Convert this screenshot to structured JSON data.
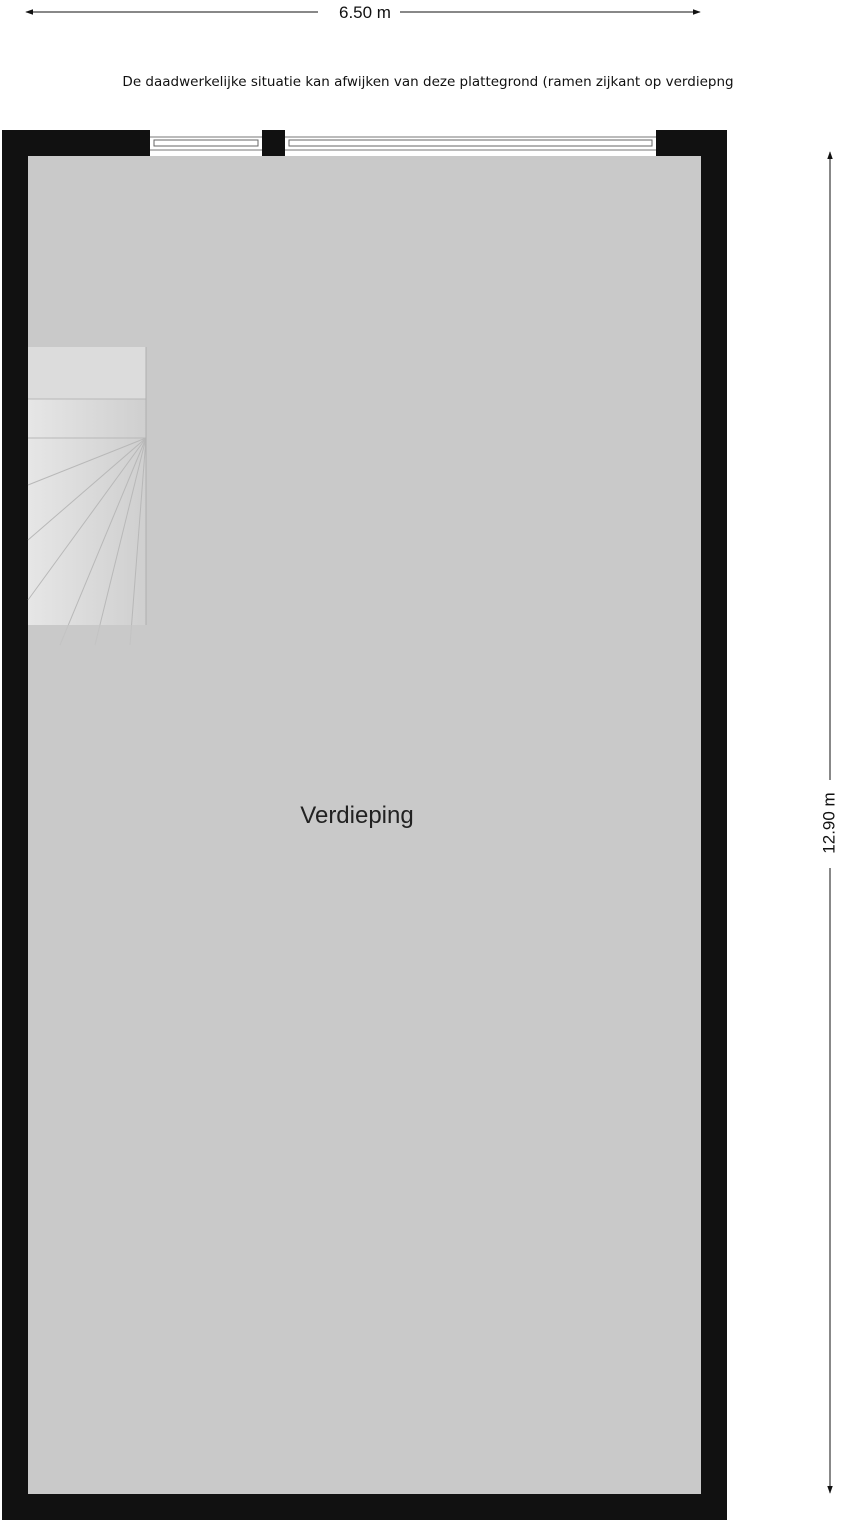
{
  "dimensions": {
    "width_label": "6.50 m",
    "height_label": "12.90 m"
  },
  "disclaimer": "De daadwerkelijke situatie kan afwijken van deze plattegrond (ramen zijkant op verdiepng",
  "rooms": [
    {
      "name": "Verdieping"
    }
  ],
  "colors": {
    "wall": "#111111",
    "floor": "#c9c9c9",
    "stair": "#dedede",
    "dimension_line": "#111111"
  }
}
